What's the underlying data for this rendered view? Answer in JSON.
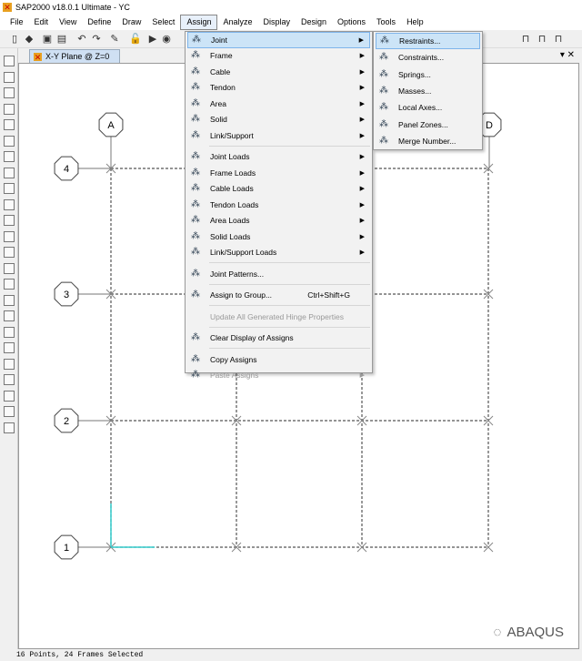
{
  "window": {
    "title": "SAP2000 v18.0.1 Ultimate  - YC"
  },
  "menubar": [
    "File",
    "Edit",
    "View",
    "Define",
    "Draw",
    "Select",
    "Assign",
    "Analyze",
    "Display",
    "Design",
    "Options",
    "Tools",
    "Help"
  ],
  "tab": {
    "label": "X-Y Plane @ Z=0"
  },
  "assign_menu": {
    "items": [
      {
        "label": "Joint",
        "icon": "joint-icon",
        "arrow": true,
        "highlight": true
      },
      {
        "label": "Frame",
        "icon": "frame-icon",
        "arrow": true
      },
      {
        "label": "Cable",
        "icon": "cable-icon",
        "arrow": true
      },
      {
        "label": "Tendon",
        "icon": "tendon-icon",
        "arrow": true
      },
      {
        "label": "Area",
        "icon": "area-icon",
        "arrow": true
      },
      {
        "label": "Solid",
        "icon": "solid-icon",
        "arrow": true
      },
      {
        "label": "Link/Support",
        "icon": "link-icon",
        "arrow": true,
        "sep": true
      },
      {
        "label": "Joint Loads",
        "icon": "joint-loads-icon",
        "arrow": true
      },
      {
        "label": "Frame Loads",
        "icon": "frame-loads-icon",
        "arrow": true
      },
      {
        "label": "Cable Loads",
        "icon": "cable-loads-icon",
        "arrow": true
      },
      {
        "label": "Tendon Loads",
        "icon": "tendon-loads-icon",
        "arrow": true
      },
      {
        "label": "Area Loads",
        "icon": "area-loads-icon",
        "arrow": true
      },
      {
        "label": "Solid Loads",
        "icon": "solid-loads-icon",
        "arrow": true
      },
      {
        "label": "Link/Support Loads",
        "icon": "link-loads-icon",
        "arrow": true,
        "sep": true
      },
      {
        "label": "Joint Patterns...",
        "icon": "joint-patterns-icon",
        "sep": true
      },
      {
        "label": "Assign to Group...",
        "icon": "group-icon",
        "shortcut": "Ctrl+Shift+G",
        "sep": true
      },
      {
        "label": "Update All Generated Hinge Properties",
        "disabled": true,
        "sep": true
      },
      {
        "label": "Clear Display of Assigns",
        "icon": "clear-display-icon",
        "sep": true
      },
      {
        "label": "Copy Assigns",
        "icon": "copy-icon"
      },
      {
        "label": "Paste Assigns",
        "icon": "paste-icon",
        "arrow": true,
        "disabled": true
      }
    ]
  },
  "joint_submenu": {
    "items": [
      {
        "label": "Restraints...",
        "icon": "restraints-icon",
        "highlight": true
      },
      {
        "label": "Constraints...",
        "icon": "constraints-icon"
      },
      {
        "label": "Springs...",
        "icon": "springs-icon"
      },
      {
        "label": "Masses...",
        "icon": "masses-icon"
      },
      {
        "label": "Local Axes...",
        "icon": "local-axes-icon"
      },
      {
        "label": "Panel Zones...",
        "icon": "panel-zones-icon"
      },
      {
        "label": "Merge Number...",
        "icon": "merge-number-icon"
      }
    ]
  },
  "grid": {
    "columns": [
      "A",
      "D"
    ],
    "rows": [
      "4",
      "3",
      "2",
      "1"
    ]
  },
  "status": "16 Points, 24 Frames Selected",
  "watermark": "ABAQUS"
}
